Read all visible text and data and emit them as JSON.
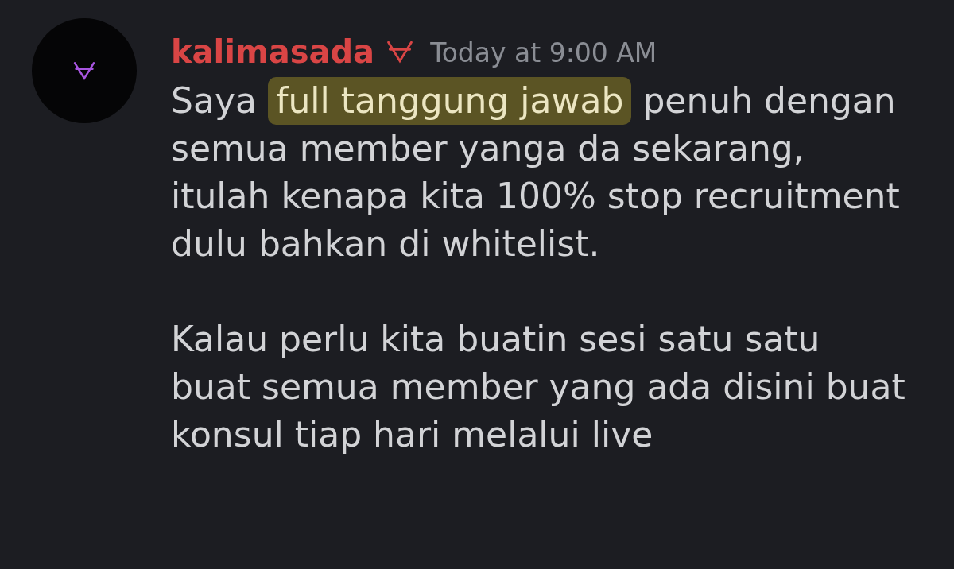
{
  "message": {
    "author": "kalimasada",
    "timestamp": "Today at 9:00 AM",
    "paragraphs": [
      {
        "lines": [
          [
            {
              "text": "Saya ",
              "highlighted": false
            },
            {
              "text": "full tanggung jawab",
              "highlighted": true
            },
            {
              "text": " penuh dengan",
              "highlighted": false
            }
          ],
          [
            {
              "text": "semua member yanga da sekarang,",
              "highlighted": false
            }
          ],
          [
            {
              "text": "itulah kenapa kita 100% stop recruitment",
              "highlighted": false
            }
          ],
          [
            {
              "text": "dulu bahkan di whitelist.",
              "highlighted": false
            }
          ]
        ]
      },
      {
        "lines": [
          [
            {
              "text": "Kalau perlu kita buatin sesi satu satu",
              "highlighted": false
            }
          ],
          [
            {
              "text": "buat semua member yang ada disini buat",
              "highlighted": false
            }
          ],
          [
            {
              "text": "konsul tiap hari melalui live",
              "highlighted": false
            }
          ]
        ]
      }
    ]
  }
}
